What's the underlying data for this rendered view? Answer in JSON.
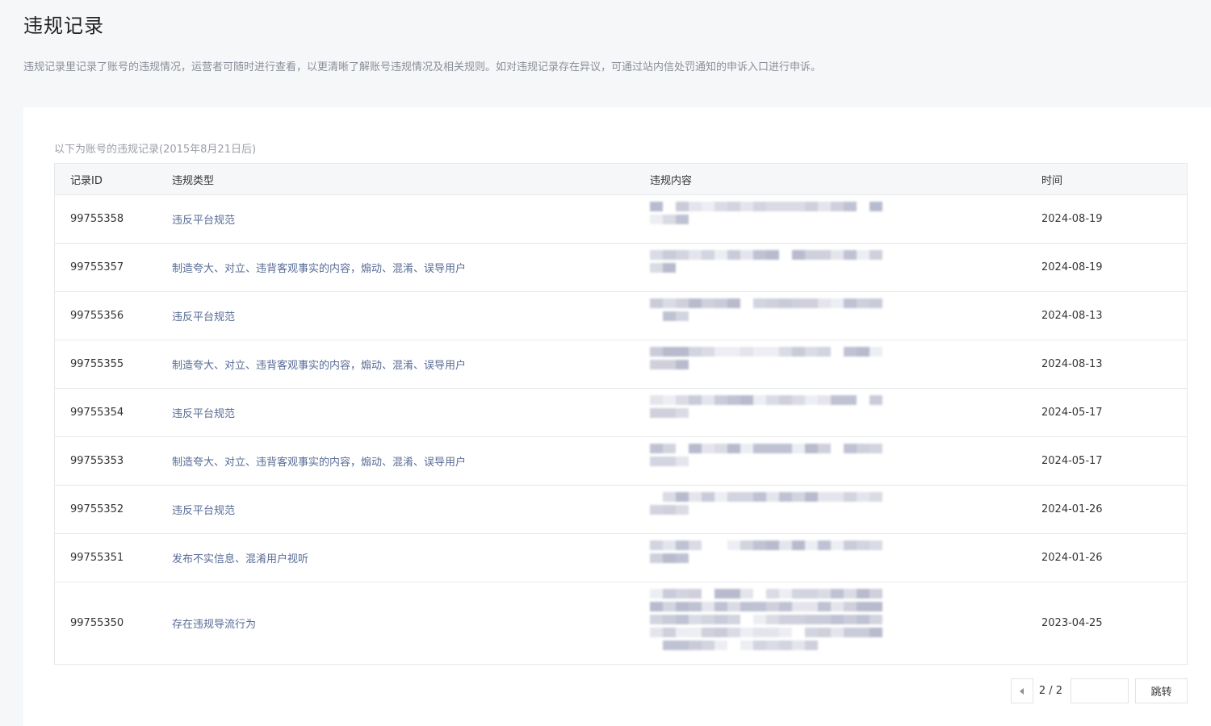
{
  "page": {
    "title": "违规记录",
    "description": "违规记录里记录了账号的违规情况，运营者可随时进行查看，以更清晰了解账号违规情况及相关规则。如对违规记录存在异议，可通过站内信处罚通知的申诉入口进行申诉。"
  },
  "records": {
    "caption": "以下为账号的违规记录(2015年8月21日后)",
    "columns": {
      "id": "记录ID",
      "type": "违规类型",
      "content": "违规内容",
      "time": "时间"
    },
    "rows": [
      {
        "id": "99755358",
        "type": "违反平台规范",
        "time": "2024-08-19"
      },
      {
        "id": "99755357",
        "type": "制造夸大、对立、违背客观事实的内容，煽动、混淆、误导用户",
        "time": "2024-08-19"
      },
      {
        "id": "99755356",
        "type": "违反平台规范",
        "time": "2024-08-13"
      },
      {
        "id": "99755355",
        "type": "制造夸大、对立、违背客观事实的内容，煽动、混淆、误导用户",
        "time": "2024-08-13"
      },
      {
        "id": "99755354",
        "type": "违反平台规范",
        "time": "2024-05-17"
      },
      {
        "id": "99755353",
        "type": "制造夸大、对立、违背客观事实的内容，煽动、混淆、误导用户",
        "time": "2024-05-17"
      },
      {
        "id": "99755352",
        "type": "违反平台规范",
        "time": "2024-01-26"
      },
      {
        "id": "99755351",
        "type": "发布不实信息、混淆用户视听",
        "time": "2024-01-26"
      },
      {
        "id": "99755350",
        "type": "存在违规导流行为",
        "time": "2023-04-25"
      }
    ]
  },
  "pagination": {
    "page_label": "2 / 2",
    "jump_value": "",
    "jump_label": "跳转"
  },
  "colors": {
    "link": "#576b95",
    "border": "#e7e8eb",
    "header_bg": "#f6f7f9"
  }
}
